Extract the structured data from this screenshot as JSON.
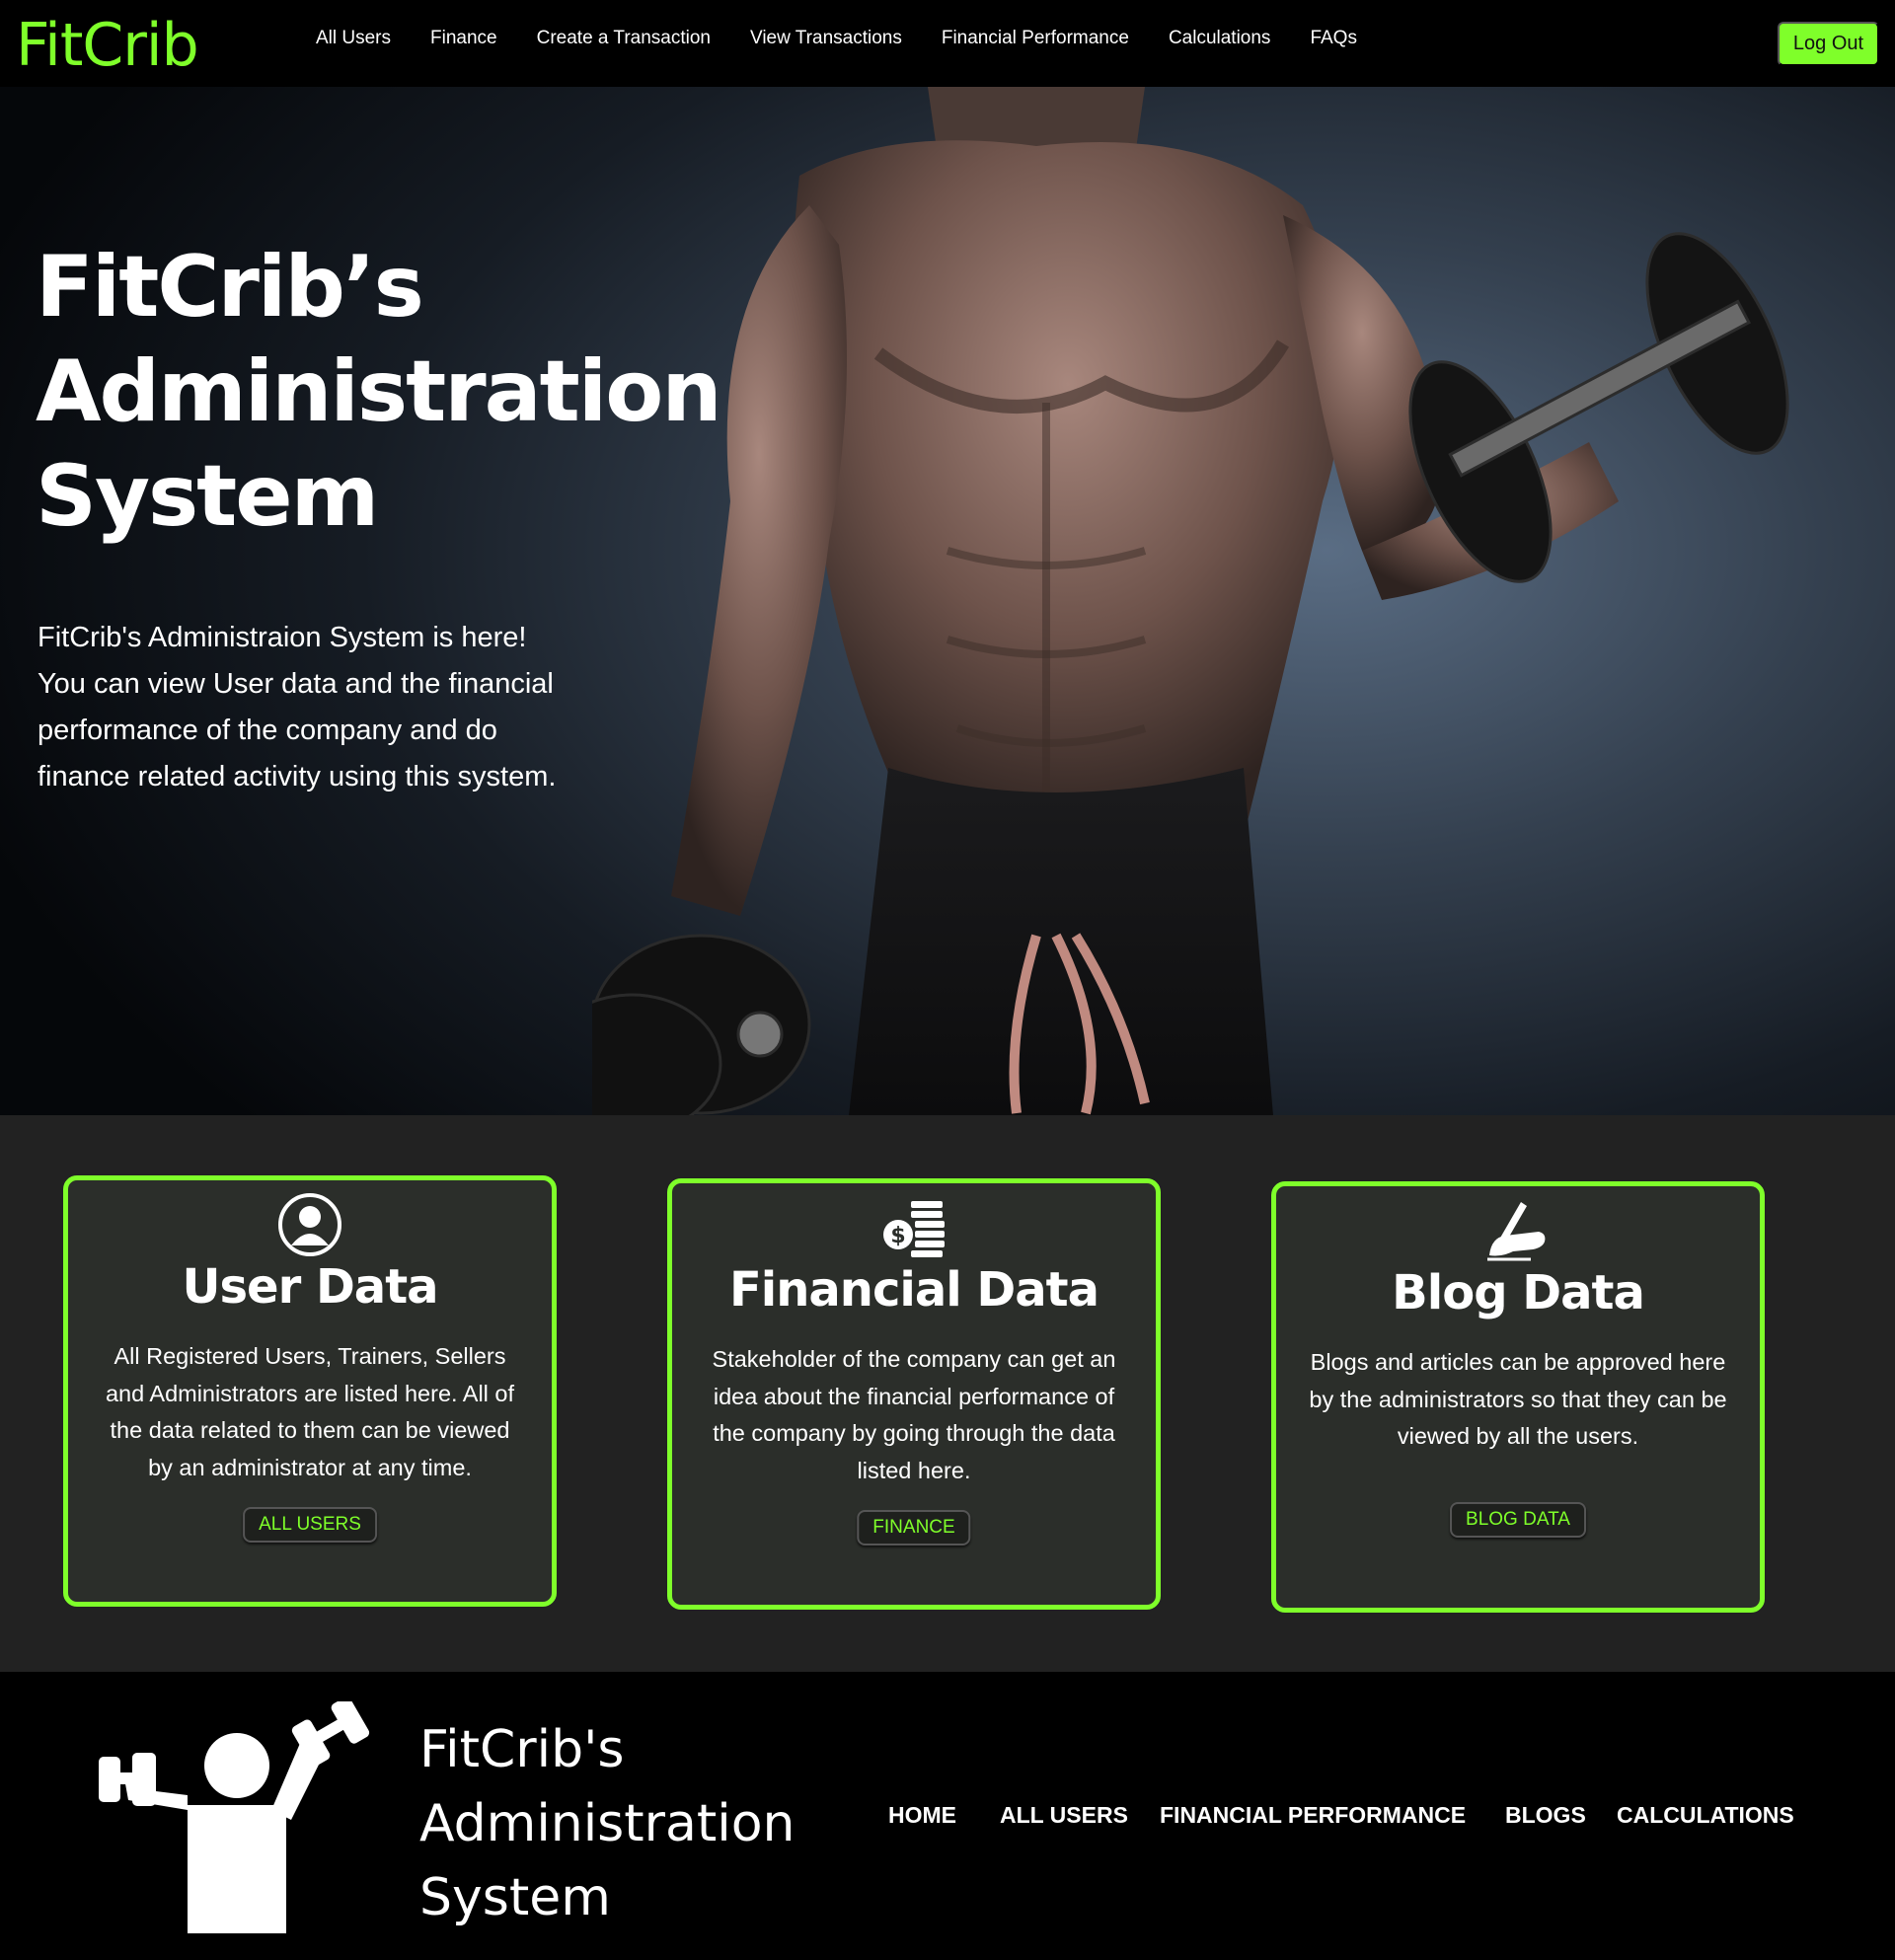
{
  "navbar": {
    "brand": "FitCrib",
    "links": [
      "All Users",
      "Finance",
      "Create a Transaction",
      "View Transactions",
      "Financial Performance",
      "Calculations",
      "FAQs"
    ],
    "logout_label": "Log Out"
  },
  "hero": {
    "title_lines": [
      "FitCrib’s",
      "Administration",
      "System"
    ],
    "description": "FitCrib's Administraion System is here! You can view User data and the financial performance of the company and do finance related activity using this system."
  },
  "cards": [
    {
      "icon": "user-icon",
      "title": "User Data",
      "text": "All Registered Users, Trainers, Sellers and Administrators are listed here. All of the data related to them can be viewed by an administrator at any time.",
      "button": "ALL USERS"
    },
    {
      "icon": "money-stack-icon",
      "title": "Financial Data",
      "text": "Stakeholder of the company can get an idea about the financial performance of the company by going through the data listed here.",
      "button": "FINANCE"
    },
    {
      "icon": "writing-hand-icon",
      "title": "Blog Data",
      "text": "Blogs and articles can be approved here by the administrators so that they can be viewed by all the users.",
      "button": "BLOG DATA"
    }
  ],
  "footer": {
    "title_lines": [
      "FitCrib's",
      "Administration",
      "System"
    ],
    "links": [
      "HOME",
      "ALL USERS",
      "FINANCIAL PERFORMANCE",
      "BLOGS",
      "CALCULATIONS"
    ]
  },
  "colors": {
    "accent": "#7fff2a",
    "page_bg": "#000000",
    "section_bg": "#222222",
    "card_bg": "#2b2e2a"
  }
}
